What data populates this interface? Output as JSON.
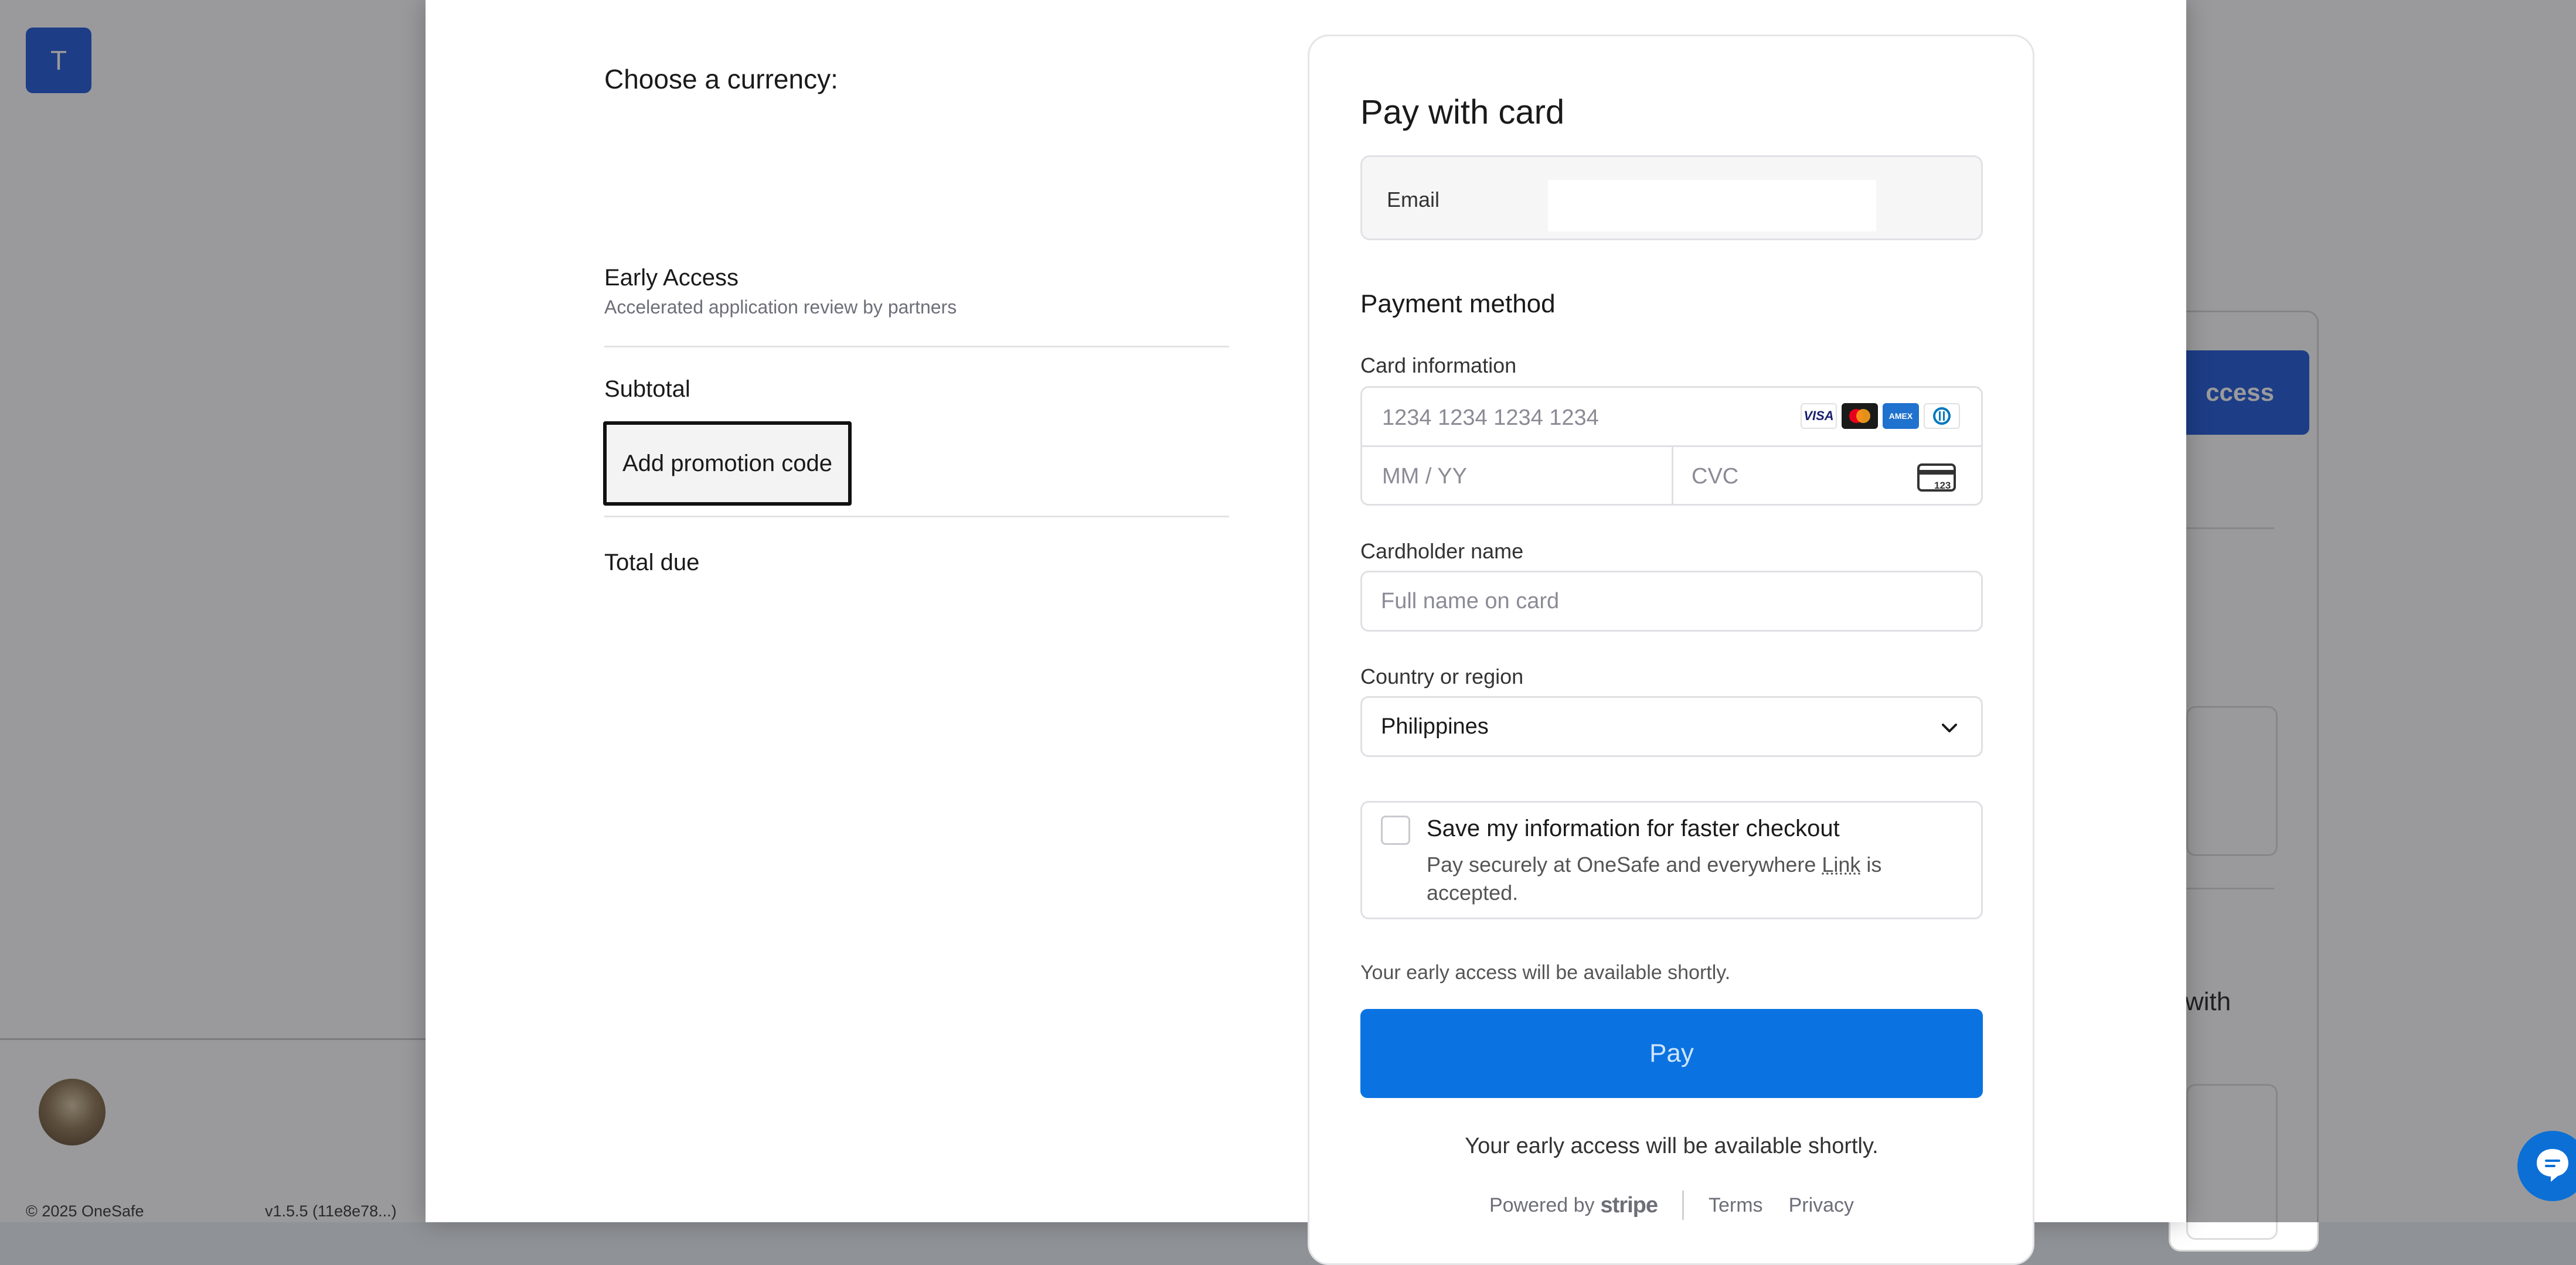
{
  "background": {
    "workspace_initial": "T",
    "copyright": "© 2025 OneSafe",
    "version": "v1.5.5 (11e8e78...)",
    "right_button_partial": "ccess",
    "right_text_partial": "with"
  },
  "summary": {
    "currency_label": "Choose a currency:",
    "item_name": "Early Access",
    "item_description": "Accelerated application review by partners",
    "subtotal_label": "Subtotal",
    "promo_button_label": "Add promotion code",
    "total_due_label": "Total due"
  },
  "payment": {
    "title": "Pay with card",
    "email_label": "Email",
    "email_value": "",
    "method_title": "Payment method",
    "card_info_label": "Card information",
    "card_number_placeholder": "1234 1234 1234 1234",
    "expiry_placeholder": "MM / YY",
    "cvc_placeholder": "CVC",
    "cvc_icon_text": "123",
    "brands": [
      "visa-icon",
      "mastercard-icon",
      "amex-icon",
      "diners-icon"
    ],
    "brand_visa_text": "VISA",
    "brand_amex_text": "AMEX",
    "cardholder_label": "Cardholder name",
    "cardholder_placeholder": "Full name on card",
    "country_label": "Country or region",
    "country_value": "Philippines",
    "save_title": "Save my information for faster checkout",
    "save_desc_prefix": "Pay securely at OneSafe and everywhere ",
    "save_desc_link": "Link",
    "save_desc_suffix": " is accepted.",
    "note_top": "Your early access will be available shortly.",
    "pay_button_label": "Pay",
    "note_bottom": "Your early access will be available shortly.",
    "powered_by": "Powered by",
    "stripe": "stripe",
    "terms": "Terms",
    "privacy": "Privacy"
  },
  "colors": {
    "pay_button": "#0a73e1",
    "brand_blue": "#1d56d8",
    "overlay": "rgba(30,30,35,0.45)"
  }
}
